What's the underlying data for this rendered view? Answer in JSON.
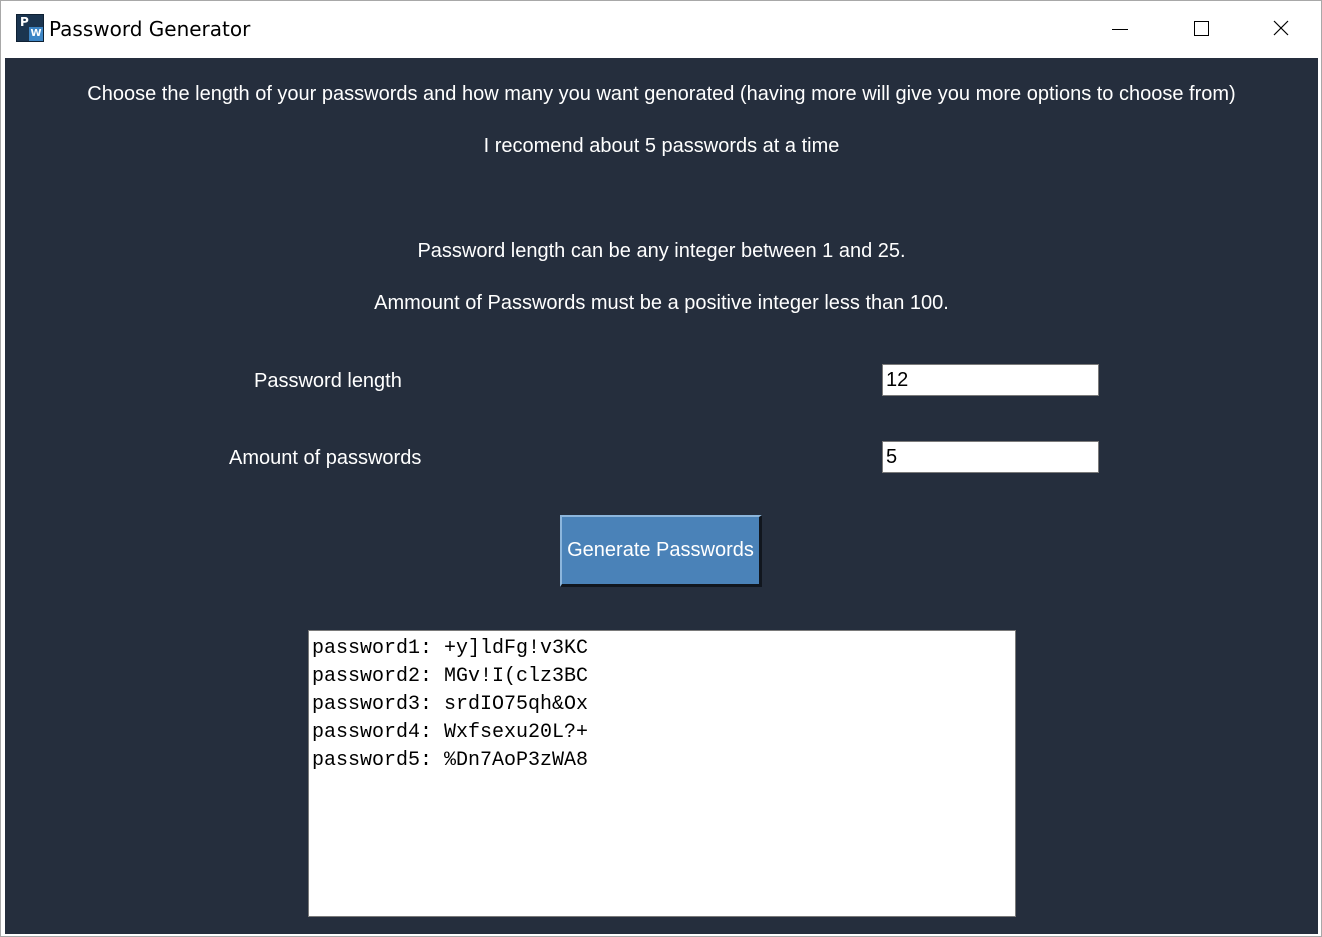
{
  "window": {
    "title": "Password Generator",
    "icon": "password-generator-app-icon",
    "icon_letters": [
      "P",
      "W"
    ],
    "controls": {
      "minimize_icon": "minimize-icon",
      "maximize_icon": "maximize-icon",
      "close_icon": "close-icon"
    }
  },
  "instructions": {
    "line1": "Choose the length of your passwords and how many you want genorated (having more will give you more options to choose from)",
    "line2": "I recomend about 5 passwords at a time",
    "line3": "Password length can be any integer between 1 and 25.",
    "line4": "Ammount of Passwords must be a positive integer less than 100."
  },
  "form": {
    "length_label": "Password length",
    "length_value": "12",
    "amount_label": "Amount of passwords",
    "amount_value": "5",
    "generate_label": "Generate Passwords"
  },
  "output": {
    "lines": [
      "password1: +y]ldFg!v3KC",
      "password2: MGv!I(clz3BC",
      "password3: srdIO75qh&Ox",
      "password4: Wxfsexu20L?+",
      "password5: %Dn7AoP3zWA8"
    ]
  },
  "colors": {
    "background": "#252e3d",
    "button": "#4a82b8",
    "text": "#ffffff"
  }
}
